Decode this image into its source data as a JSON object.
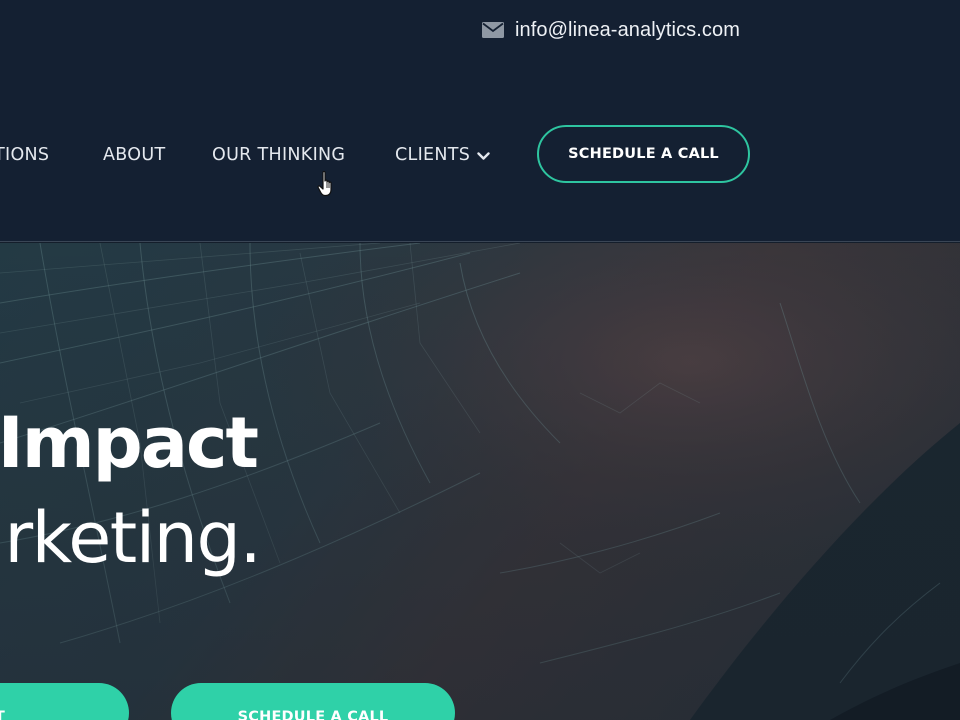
{
  "header": {
    "email": "info@linea-analytics.com",
    "email_icon": "envelope-icon",
    "nav": {
      "solutions": "TIONS",
      "about": "ABOUT",
      "thinking": "OUR THINKING",
      "clients": "CLIENTS",
      "clients_icon": "chevron-down-icon"
    },
    "cta_label": "SCHEDULE A CALL"
  },
  "hero": {
    "title": "ue Impact",
    "subtitle": "arketing.",
    "primary_button_label": "T",
    "secondary_button_label": "SCHEDULE A CALL"
  },
  "colors": {
    "header_bg": "#142032",
    "accent": "#2fd1a8",
    "text": "#ffffff"
  }
}
